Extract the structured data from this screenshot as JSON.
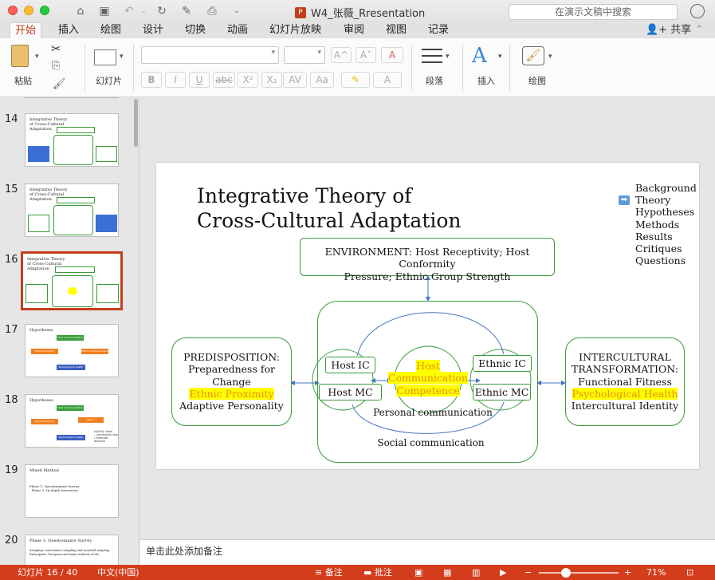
{
  "window": {
    "title": "W4_张薇_Rresentation",
    "search_placeholder": "在演示文稿中搜索"
  },
  "tabs": [
    "开始",
    "插入",
    "绘图",
    "设计",
    "切换",
    "动画",
    "幻灯片放映",
    "审阅",
    "视图",
    "记录"
  ],
  "share_label": "共享",
  "ribbon": {
    "paste": "粘贴",
    "slides": "幻灯片",
    "paragraph": "段落",
    "insert": "插入",
    "draw": "绘图",
    "bold": "B",
    "italic": "I",
    "underline": "U",
    "strike": "abc",
    "superscript": "X²",
    "subscript": "X₂",
    "spacing": "AV",
    "case": "Aa",
    "grow": "A^",
    "shrink": "A˅",
    "clear": "A",
    "font_color": "A"
  },
  "thumbs": [
    {
      "num": "14",
      "title": "Integrative Theory of Cross-Cultural Adaptation"
    },
    {
      "num": "15",
      "title": "Integrative Theory of Cross-Cultural Adaptation"
    },
    {
      "num": "16",
      "title": "Integrative Theory of Cross-Cultural Adaptation"
    },
    {
      "num": "17",
      "title": "Hypotheses"
    },
    {
      "num": "18",
      "title": "Hypotheses"
    },
    {
      "num": "19",
      "title": "Mixed Method",
      "body": "Phase 1: Questionnaire Survey · Phase 2: In-depth Interviews"
    },
    {
      "num": "20",
      "title": "Phase 1: Questionnaire Survey"
    }
  ],
  "thumb_labels": {
    "host_comm": "Host Communication",
    "psych_health": "Psychological health",
    "ethnic_prox": "Ethnic Proximity",
    "ethnic_comm": "Ethnic Communication",
    "hypo_note": "H4(H5): Host ...correlation test / thematic analysis",
    "survey_sampling": "Sampling: convenience sampling and snowball sampling",
    "survey_participants": "Participants: European and Asian students of the"
  },
  "slide": {
    "title_line1": "Integrative Theory of",
    "title_line2": "Cross-Cultural Adaptation",
    "nav": [
      "Background",
      "Theory",
      "Hypotheses",
      "Methods",
      "Results",
      "Critiques",
      "Questions"
    ],
    "environment_line1": "ENVIRONMENT: Host Receptivity; Host Conformity",
    "environment_line2": "Pressure; Ethnic Group Strength",
    "pred_1": "PREDISPOSITION:",
    "pred_2": "Preparedness for",
    "pred_3": "Change",
    "pred_4": "Ethnic Proximity",
    "pred_5": "Adaptive Personality",
    "inter_1": "INTERCULTURAL",
    "inter_2": "TRANSFORMATION:",
    "inter_3": "Functional Fitness",
    "inter_4": "Psychological Health",
    "inter_5": "Intercultural Identity",
    "host_ic": "Host IC",
    "host_mc": "Host MC",
    "ethnic_ic": "Ethnic IC",
    "ethnic_mc": "Ethnic MC",
    "hcc_1": "Host",
    "hcc_2": "Communication",
    "hcc_3": "Competence",
    "personal_comm": "Personal communication",
    "social_comm": "Social communication"
  },
  "notes_placeholder": "单击此处添加备注",
  "status": {
    "slide_info": "幻灯片 16 / 40",
    "language": "中文(中国)",
    "notes_btn": "备注",
    "comments_btn": "批注",
    "zoom": "71%"
  }
}
